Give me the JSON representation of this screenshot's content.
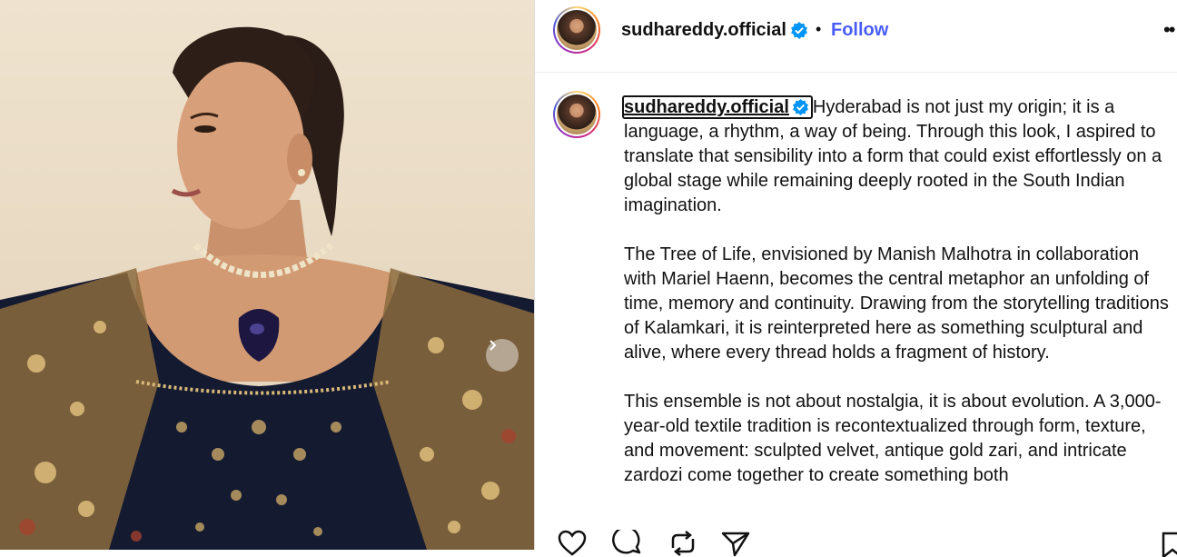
{
  "post": {
    "username": "sudhareddy.official",
    "separator": "•",
    "follow_label": "Follow",
    "more_label": "••",
    "caption_paragraphs": [
      "Hyderabad is not just my origin; it is a language, a rhythm, a way of being. Through this look, I aspired to translate that sensibility into a form that could exist effortlessly on a global stage while remaining deeply rooted in the South Indian imagination.",
      "The Tree of Life, envisioned by Manish Malhotra in collaboration with Mariel Haenn, becomes the central metaphor an unfolding of time, memory and continuity. Drawing from the storytelling traditions of Kalamkari, it is reinterpreted here as something sculptural and alive, where every thread holds a fragment of history.",
      "This ensemble is not about nostalgia, it is about evolution. A 3,000-year-old textile tradition is recontextualized through form, texture, and movement: sculpted velvet, antique gold zari, and intricate zardozi come together to create something both"
    ]
  },
  "colors": {
    "follow": "#4a5df9",
    "verified": "#0095f6",
    "divider": "#dbdbdb"
  },
  "icons": [
    "verified-badge-icon",
    "heart-icon",
    "comment-icon",
    "share-icon",
    "send-icon",
    "save-icon",
    "chevron-right-icon"
  ]
}
